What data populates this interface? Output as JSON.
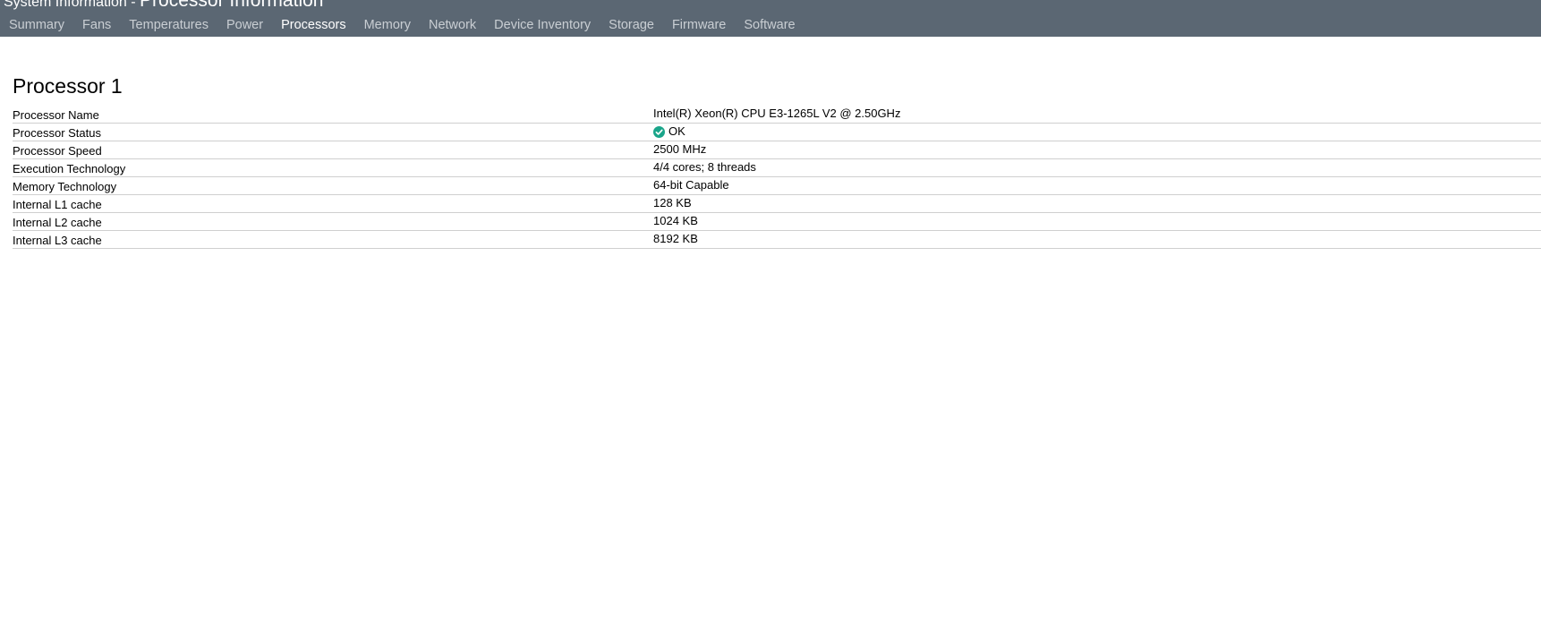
{
  "header": {
    "title_prefix": "System Information - ",
    "title_main": "Processor Information",
    "tabs": [
      {
        "label": "Summary",
        "active": false
      },
      {
        "label": "Fans",
        "active": false
      },
      {
        "label": "Temperatures",
        "active": false
      },
      {
        "label": "Power",
        "active": false
      },
      {
        "label": "Processors",
        "active": true
      },
      {
        "label": "Memory",
        "active": false
      },
      {
        "label": "Network",
        "active": false
      },
      {
        "label": "Device Inventory",
        "active": false
      },
      {
        "label": "Storage",
        "active": false
      },
      {
        "label": "Firmware",
        "active": false
      },
      {
        "label": "Software",
        "active": false
      }
    ]
  },
  "processor": {
    "title": "Processor 1",
    "rows": [
      {
        "label": "Processor Name",
        "value": "Intel(R) Xeon(R) CPU E3-1265L V2 @ 2.50GHz"
      },
      {
        "label": "Processor Status",
        "value": "OK",
        "icon": "check-circle-icon"
      },
      {
        "label": "Processor Speed",
        "value": "2500 MHz"
      },
      {
        "label": "Execution Technology",
        "value": "4/4 cores; 8 threads"
      },
      {
        "label": "Memory Technology",
        "value": "64-bit Capable"
      },
      {
        "label": "Internal L1 cache",
        "value": "128 KB"
      },
      {
        "label": "Internal L2 cache",
        "value": "1024 KB"
      },
      {
        "label": "Internal L3 cache",
        "value": "8192 KB"
      }
    ]
  },
  "colors": {
    "header_bg": "#5b6773",
    "tab_inactive": "#c9ced3",
    "tab_active": "#ffffff",
    "status_ok": "#1aa58a",
    "row_divider": "#cfcfcf"
  }
}
